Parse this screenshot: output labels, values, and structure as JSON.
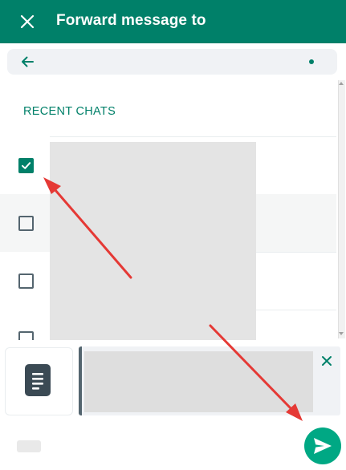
{
  "header": {
    "title": "Forward message to",
    "close_icon": "close-icon"
  },
  "search": {
    "back_icon": "arrow-left-icon",
    "value": ""
  },
  "list": {
    "section_title": "RECENT CHATS",
    "rows": [
      {
        "checked": true
      },
      {
        "checked": false,
        "highlighted": true
      },
      {
        "checked": false
      },
      {
        "checked": false
      }
    ]
  },
  "preview": {
    "document_icon": "document-icon",
    "close_icon": "close-icon"
  },
  "send": {
    "icon": "send-icon"
  },
  "colors": {
    "header": "#008069",
    "accent": "#00a884",
    "annotation_arrow": "#e53935"
  }
}
